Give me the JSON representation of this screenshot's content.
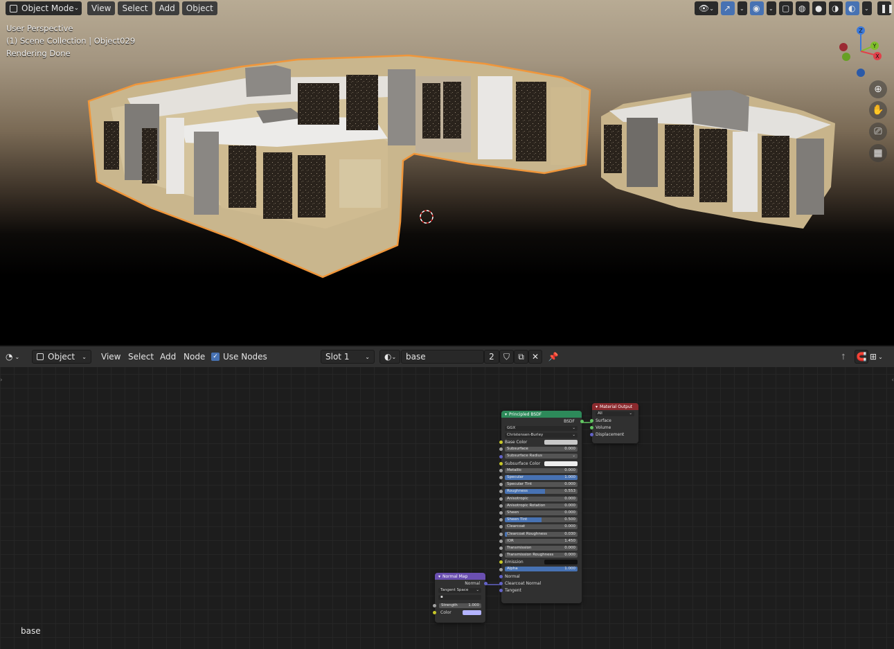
{
  "viewport": {
    "header": {
      "mode": "Object Mode",
      "menus": [
        "View",
        "Select",
        "Add",
        "Object"
      ]
    },
    "overlay": {
      "perspective": "User Perspective",
      "collection": "(1) Scene Collection | Object029",
      "status": "Rendering Done"
    },
    "gizmo": {
      "z": "Z",
      "y": "Y",
      "x": "X"
    }
  },
  "node_editor": {
    "header": {
      "editor_type": "Object",
      "menus": [
        "View",
        "Select",
        "Add",
        "Node"
      ],
      "use_nodes_label": "Use Nodes",
      "use_nodes": true,
      "slot": "Slot 1",
      "material_name": "base",
      "users": "2"
    },
    "corner_label": "base",
    "principled": {
      "title": "Principled BSDF",
      "output": "BSDF",
      "distribution": "GGX",
      "subsurface_method": "Christensen-Burley",
      "inputs": [
        {
          "label": "Base Color",
          "kind": "color",
          "color": "#c8c8c8"
        },
        {
          "label": "Subsurface",
          "kind": "value",
          "value": "0.000",
          "fill": 0
        },
        {
          "label": "Subsurface Radius",
          "kind": "dropdown"
        },
        {
          "label": "Subsurface Color",
          "kind": "color",
          "color": "#eeeeee"
        },
        {
          "label": "Metallic",
          "kind": "value",
          "value": "0.000",
          "fill": 0
        },
        {
          "label": "Specular",
          "kind": "value",
          "value": "1.000",
          "fill": 1
        },
        {
          "label": "Specular Tint",
          "kind": "value",
          "value": "0.000",
          "fill": 0
        },
        {
          "label": "Roughness",
          "kind": "value",
          "value": "0.553",
          "fill": 0.553
        },
        {
          "label": "Anisotropic",
          "kind": "value",
          "value": "0.000",
          "fill": 0
        },
        {
          "label": "Anisotropic Rotation",
          "kind": "value",
          "value": "0.000",
          "fill": 0
        },
        {
          "label": "Sheen",
          "kind": "value",
          "value": "0.000",
          "fill": 0
        },
        {
          "label": "Sheen Tint",
          "kind": "value",
          "value": "0.500",
          "fill": 0.5
        },
        {
          "label": "Clearcoat",
          "kind": "value",
          "value": "0.000",
          "fill": 0
        },
        {
          "label": "Clearcoat Roughness",
          "kind": "value",
          "value": "0.030",
          "fill": 0.03
        },
        {
          "label": "IOR",
          "kind": "value",
          "value": "1.450",
          "fill": 0
        },
        {
          "label": "Transmission",
          "kind": "value",
          "value": "0.000",
          "fill": 0
        },
        {
          "label": "Transmission Roughness",
          "kind": "value",
          "value": "0.000",
          "fill": 0
        },
        {
          "label": "Emission",
          "kind": "color",
          "color": "#111111"
        },
        {
          "label": "Alpha",
          "kind": "value",
          "value": "1.000",
          "fill": 1
        },
        {
          "label": "Normal",
          "kind": "socket"
        },
        {
          "label": "Clearcoat Normal",
          "kind": "socket"
        },
        {
          "label": "Tangent",
          "kind": "socket"
        }
      ]
    },
    "material_output": {
      "title": "Material Output",
      "target": "All",
      "inputs": [
        "Surface",
        "Volume",
        "Displacement"
      ]
    },
    "normal_map": {
      "title": "Normal Map",
      "output": "Normal",
      "space": "Tangent Space",
      "uv": "",
      "strength_label": "Strength",
      "strength": "1.000",
      "color_label": "Color",
      "color": "#b4b4ff"
    },
    "colors": {
      "principled_header": "#2d8a5a",
      "output_header": "#8b2a2e",
      "vector_header": "#6a4fb0",
      "accent": "#4772b3",
      "selection": "#f09a3a"
    }
  }
}
